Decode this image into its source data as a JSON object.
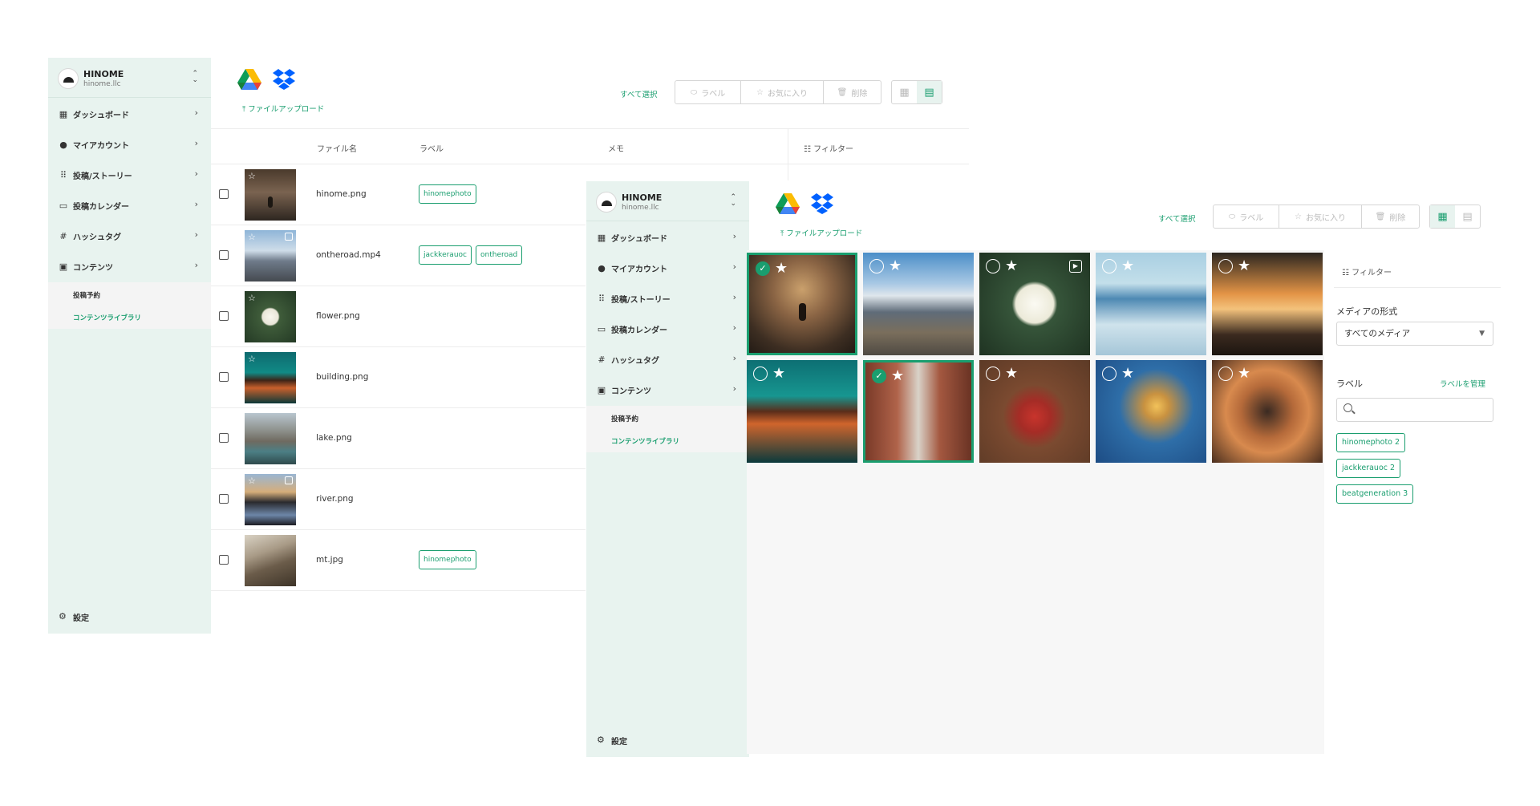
{
  "brand": {
    "name": "HINOME",
    "domain": "hinome.llc"
  },
  "sidebar": {
    "items": [
      {
        "label": "ダッシュボード",
        "icon": "dashboard-icon"
      },
      {
        "label": "マイアカウント",
        "icon": "account-icon"
      },
      {
        "label": "投稿/ストーリー",
        "icon": "posts-icon"
      },
      {
        "label": "投稿カレンダー",
        "icon": "calendar-icon"
      },
      {
        "label": "ハッシュタグ",
        "icon": "hashtag-icon"
      },
      {
        "label": "コンテンツ",
        "icon": "content-icon"
      }
    ],
    "subitems": [
      {
        "label": "投稿予約"
      },
      {
        "label": "コンテンツライブラリ"
      }
    ],
    "settings": "設定"
  },
  "toolbar": {
    "upload": "ファイルアップロード",
    "select_all": "すべて選択",
    "label_btn": "ラベル",
    "favorite_btn": "お気に入り",
    "delete_btn": "削除"
  },
  "list": {
    "columns": {
      "filename": "ファイル名",
      "label": "ラベル",
      "memo": "メモ"
    },
    "rows": [
      {
        "name": "hinome.png",
        "tags": [
          "hinomephoto"
        ]
      },
      {
        "name": "ontheroad.mp4",
        "tags": [
          "jackkerauoc",
          "ontheroad"
        ]
      },
      {
        "name": "flower.png",
        "tags": []
      },
      {
        "name": "building.png",
        "tags": []
      },
      {
        "name": "lake.png",
        "tags": []
      },
      {
        "name": "river.png",
        "tags": []
      },
      {
        "name": "mt.jpg",
        "tags": [
          "hinomephoto"
        ]
      }
    ]
  },
  "filter": {
    "title": "フィルター",
    "media_type_label": "メディアの形式",
    "media_type_value": "すべてのメディア",
    "label_heading": "ラベル",
    "manage_labels": "ラベルを管理",
    "labels": [
      {
        "name": "hinomephoto",
        "count": "2"
      },
      {
        "name": "jackkerauoc",
        "count": "2"
      },
      {
        "name": "beatgeneration",
        "count": "3"
      }
    ]
  },
  "colors": {
    "accent": "#1a9e6f",
    "sidebar_bg": "#e8f3ef"
  }
}
